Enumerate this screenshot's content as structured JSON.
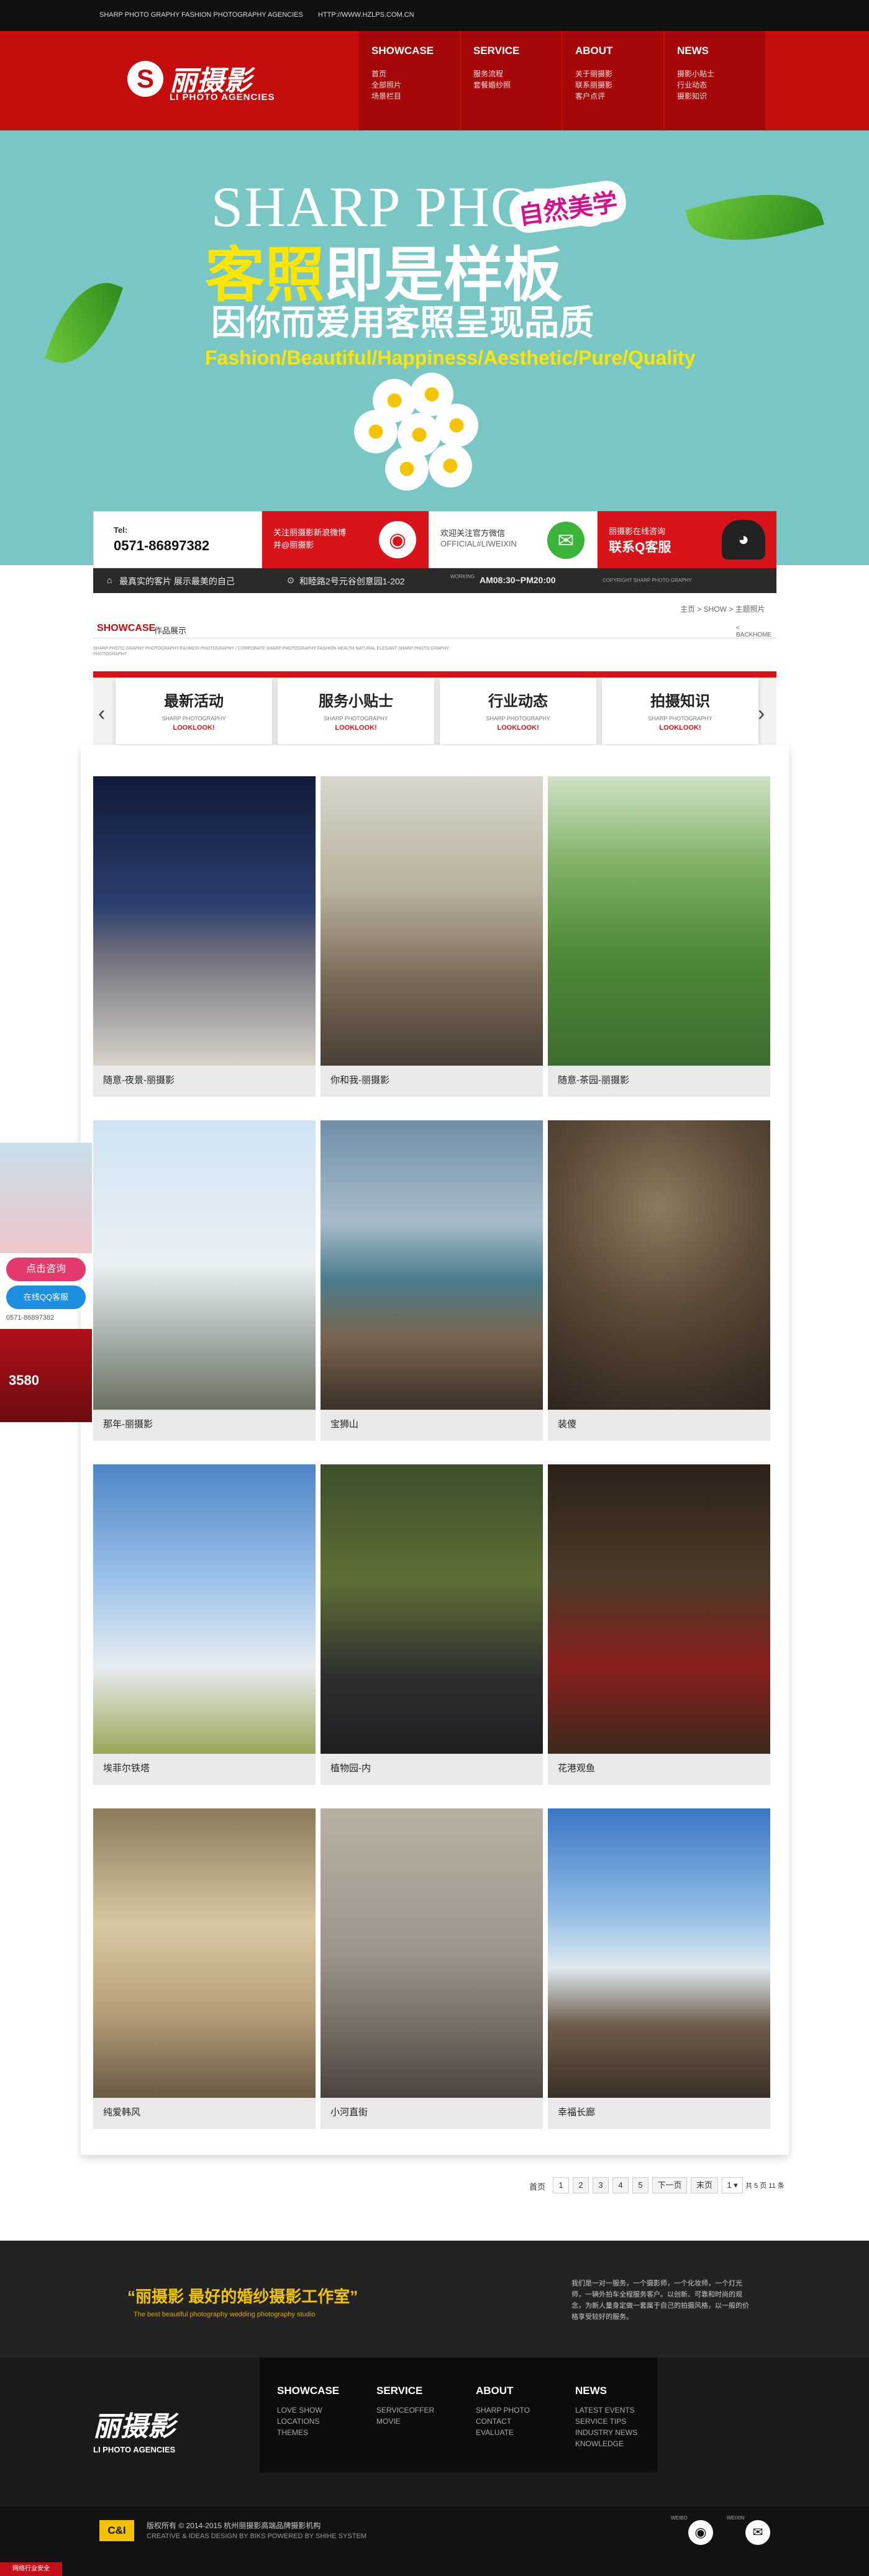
{
  "top_strip": {
    "left_text": "SHARP PHOTO GRAPHY FASHION PHOTOGRAPHY AGENCIES",
    "right_text": "HTTP://WWW.HZLPS.COM.CN"
  },
  "brand": {
    "name": "丽摄影",
    "en": "LI PHOTO AGENCIES",
    "mark": "S"
  },
  "nav": [
    {
      "title": "SHOWCASE",
      "items": [
        "首页",
        "全部照片",
        "场景栏目"
      ]
    },
    {
      "title": "SERVICE",
      "items": [
        "服务流程",
        "套餐婚纱照"
      ]
    },
    {
      "title": "ABOUT",
      "items": [
        "关于丽摄影",
        "联系丽摄影",
        "客户点评"
      ]
    },
    {
      "title": "NEWS",
      "items": [
        "摄影小贴士",
        "行业动态",
        "摄影知识"
      ]
    }
  ],
  "banner": {
    "line1": "SHARP PHOTO",
    "badge": "自然美学",
    "line2_a": "客照",
    "line2_b": "即是样板",
    "line3": "因你而爱用客照呈现品质",
    "line4": "Fashion/Beautiful/Happiness/Aesthetic/Pure/Quality"
  },
  "contact": {
    "tel_label": "Tel:",
    "tel": "0571-86897382",
    "weibo_text_1": "关注丽摄影新浪微博",
    "weibo_text_2": "并@丽摄影",
    "wechat_text_1": "欢迎关注官方微信",
    "wechat_text_2": "OFFICIAL#LIWEIXIN",
    "qq_text_1": "丽摄影在线咨询",
    "qq_text_2": "联系Q客服"
  },
  "info": {
    "slogan": "最真实的客片 展示最美的自己",
    "address": "和睦路2号元谷创意园1-202",
    "hours_label": "WORKING",
    "hours": "AM08:30~PM20:00",
    "copyright": "COPYRIGHT SHARP PHOTO GRAPHY"
  },
  "showcase": {
    "title_en": "SHOWCASE",
    "title_cn": "作品展示",
    "breadcrumb": "主页 > SHOW > 主题照片",
    "back": "< BACKHOME",
    "small_text": "SHARP PHOTO GRAPHY PHOTOGRAPHY/FASHION PHOTOGRAPHY / CORPORATE SHARP PHOTOGRAPHY FASHION HEALTH NATURAL ELEGANT SHARP PHOTO GRAPHY PHOTOGRAPHY"
  },
  "tabs": [
    {
      "title": "最新活动",
      "sub": "SHARP PHOTOGRAPHY",
      "link": "LOOKLOOK!"
    },
    {
      "title": "服务小贴士",
      "sub": "SHARP PHOTOGRAPHY",
      "link": "LOOKLOOK!"
    },
    {
      "title": "行业动态",
      "sub": "SHARP PHOTOGRAPHY",
      "link": "LOOKLOOK!"
    },
    {
      "title": "拍摄知识",
      "sub": "SHARP PHOTOGRAPHY",
      "link": "LOOKLOOK!"
    }
  ],
  "gallery": [
    {
      "caption": "随意-夜景-丽摄影"
    },
    {
      "caption": "你和我-丽摄影"
    },
    {
      "caption": "随意-茶园-丽摄影"
    },
    {
      "caption": "那年-丽摄影"
    },
    {
      "caption": "宝狮山"
    },
    {
      "caption": "装傻"
    },
    {
      "caption": "埃菲尔铁塔"
    },
    {
      "caption": "植物园-内"
    },
    {
      "caption": "花港观鱼"
    },
    {
      "caption": "纯爱韩风"
    },
    {
      "caption": "小河直街"
    },
    {
      "caption": "幸福长廊"
    }
  ],
  "pager": {
    "first": "首页",
    "pages": [
      "1",
      "2",
      "3",
      "4",
      "5"
    ],
    "next": "下一页",
    "last": "末页",
    "select": "1",
    "total": "共 5 页 11 条"
  },
  "sidebar": {
    "consult": "点击咨询",
    "qq": "在线QQ客服",
    "phone": "0571-86897382",
    "days": "3580"
  },
  "footer": {
    "slogan_cn": "“丽摄影  最好的婚纱摄影工作室”",
    "slogan_en": "The best beautiful photography wedding photography studio",
    "about": "我们是一对一服务，一个摄影师，一个化妆师，一个灯光师，一辆外拍车全程服务客户。以创新、可靠和时尚的观念，为新人量身定做一套属于自己的拍摄风格，以一般的价格享受较好的服务。",
    "cols": [
      {
        "title": "SHOWCASE",
        "items": [
          "LOVE SHOW",
          "LOCATIONS",
          "THEMES"
        ]
      },
      {
        "title": "SERVICE",
        "items": [
          "SERVICEOFFER",
          "MOVIE"
        ]
      },
      {
        "title": "ABOUT",
        "items": [
          "SHARP PHOTO",
          "CONTACT",
          "EVALUATE"
        ]
      },
      {
        "title": "NEWS",
        "items": [
          "LATEST EVENTS",
          "SERVICE TIPS",
          "INDUSTRY NEWS",
          "KNOWLEDGE"
        ]
      }
    ],
    "badge": "C&I",
    "copy1": "版权所有 © 2014-2015 杭州丽摄影高端品牌摄影机构",
    "copy2": "CREATIVE & IDEAS DESIGN BY BIKS POWERED BY SHIHE SYSTEM",
    "weibo": "WEIBO",
    "wechat": "WEIXIN",
    "bottom_badge": "网络行业安全"
  },
  "colors": {
    "brand_red": "#c50d0d",
    "accent_yellow": "#ffe600",
    "banner_teal": "#79c7c4"
  }
}
